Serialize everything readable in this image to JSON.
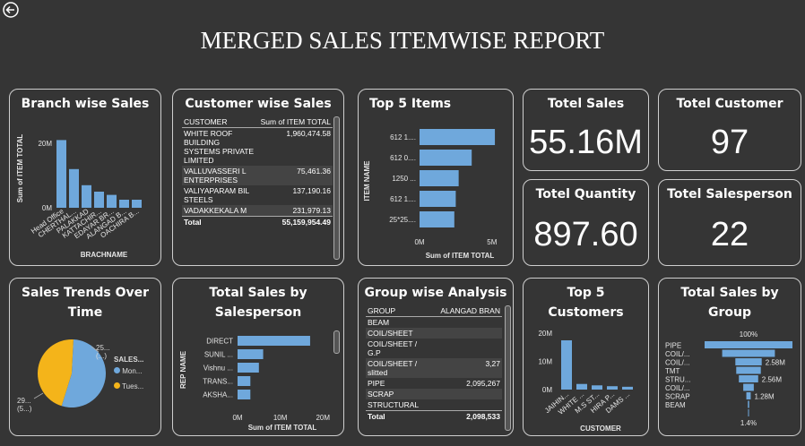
{
  "page": {
    "title": "MERGED SALES ITEMWISE REPORT",
    "accent": "#6fa8dc",
    "secondary": "#f4b41a"
  },
  "cards": {
    "branch": {
      "title": "Branch wise Sales",
      "ylabel": "Sum of ITEM TOTAL",
      "xlabel": "BRACHNAME"
    },
    "customer": {
      "title": "Customer wise Sales",
      "col1": "CUSTOMER",
      "col2": "Sum of ITEM TOTAL"
    },
    "top5items": {
      "title": "Top 5 Items",
      "ylabel": "ITEM NAME",
      "xlabel": "Sum of ITEM TOTAL"
    },
    "totel_sales": {
      "title": "Totel Sales",
      "value": "55.16M"
    },
    "totel_customer": {
      "title": "Totel Customer",
      "value": "97"
    },
    "totel_quantity": {
      "title": "Totel Quantity",
      "value": "897.60"
    },
    "totel_salesperson": {
      "title": "Totel Salesperson",
      "value": "22"
    },
    "trends": {
      "title": "Sales Trends Over Time",
      "legend_title": "SALES...",
      "legend_items": [
        "Mon...",
        "Tues..."
      ],
      "label_top": "25...",
      "label_top2": "(...)",
      "label_bottom": "29...",
      "label_bottom2": "(5...)"
    },
    "salesperson": {
      "title": "Total Sales by Salesperson",
      "ylabel": "REP NAME",
      "xlabel": "Sum of ITEM TOTAL"
    },
    "group": {
      "title": "Group wise Analysis",
      "col1": "GROUP",
      "col2": "ALANGAD BRAN"
    },
    "top5cust": {
      "title": "Top 5 Customers",
      "xlabel": "CUSTOMER"
    },
    "salesgroup": {
      "title": "Total Sales by Group",
      "top_label": "100%",
      "bottom_label": "1.4%"
    }
  },
  "customer_rows": [
    {
      "name": "WHITE ROOF BUILDING SYSTEMS PRIVATE LIMITED",
      "value": "1,960,474.58"
    },
    {
      "name": "VALLUVASSERI L ENTERPRISES",
      "value": "75,461.36"
    },
    {
      "name": "VALIYAPARAM BIL STEELS",
      "value": "137,190.16"
    },
    {
      "name": "VADAKKEKALA M",
      "value": "231,979.13"
    }
  ],
  "customer_total": {
    "label": "Total",
    "value": "55,159,954.49"
  },
  "group_rows": [
    {
      "name": "BEAM",
      "value": ""
    },
    {
      "name": "COIL/SHEET",
      "value": ""
    },
    {
      "name": "COIL/SHEET / G.P",
      "value": ""
    },
    {
      "name": "COIL/SHEET / slitted",
      "value": "3,27"
    },
    {
      "name": "PIPE",
      "value": "2,095,267"
    },
    {
      "name": "SCRAP",
      "value": ""
    },
    {
      "name": "STRUCTURAL",
      "value": ""
    }
  ],
  "group_total": {
    "label": "Total",
    "value": "2,098,533"
  },
  "chart_data": [
    {
      "type": "bar",
      "title": "Branch wise Sales",
      "categories": [
        "Head Office",
        "CHERTHAL...",
        "PALAKKAD",
        "KATTACHIR...",
        "EDAYAR BR...",
        "ALANGAD B...",
        "OACHIRA B..."
      ],
      "values": [
        21,
        12,
        7,
        5,
        4,
        2.5,
        2.5
      ],
      "ylim": [
        0,
        25
      ],
      "yticks": [
        0,
        20
      ],
      "ytick_labels": [
        "0M",
        "20M"
      ],
      "xlabel": "BRACHNAME",
      "ylabel": "Sum of ITEM TOTAL"
    },
    {
      "type": "bar",
      "orientation": "horizontal",
      "title": "Top 5 Items",
      "categories": [
        "612 1....",
        "612 0....",
        "1250 ...",
        "612 1....",
        "25*25...."
      ],
      "values": [
        5.2,
        3.6,
        2.7,
        2.5,
        2.4
      ],
      "xlim": [
        0,
        6
      ],
      "xticks": [
        0,
        5
      ],
      "xtick_labels": [
        "0M",
        "5M"
      ],
      "xlabel": "Sum of ITEM TOTAL",
      "ylabel": "ITEM NAME"
    },
    {
      "type": "pie",
      "title": "Sales Trends Over Time",
      "labels": [
        "Mon...",
        "Tues..."
      ],
      "values": [
        54,
        46
      ],
      "colors": [
        "#6fa8dc",
        "#f4b41a"
      ]
    },
    {
      "type": "bar",
      "orientation": "horizontal",
      "title": "Total Sales by Salesperson",
      "categories": [
        "DIRECT",
        "SUNIL ...",
        "Vishnu ...",
        "TRANS...",
        "AKSHA..."
      ],
      "values": [
        17,
        6,
        5,
        3,
        3
      ],
      "xlim": [
        0,
        21
      ],
      "xticks": [
        0,
        10,
        20
      ],
      "xtick_labels": [
        "0M",
        "10M",
        "20M"
      ],
      "xlabel": "Sum of ITEM TOTAL",
      "ylabel": "REP NAME"
    },
    {
      "type": "bar",
      "title": "Top 5 Customers",
      "categories": [
        "JAIHIN...",
        "WHITE ...",
        "M.S ST...",
        "HIRA P...",
        "DAMS ..."
      ],
      "values": [
        17.5,
        2.0,
        1.5,
        1.2,
        1.0
      ],
      "ylim": [
        0,
        21
      ],
      "yticks": [
        0,
        10,
        20
      ],
      "ytick_labels": [
        "0M",
        "10M",
        "20M"
      ],
      "xlabel": "CUSTOMER"
    },
    {
      "type": "funnel",
      "title": "Total Sales by Group",
      "categories": [
        "PIPE",
        "COIL/...",
        "COIL/...",
        "TMT",
        "STRU...",
        "COIL/...",
        "SCRAP",
        "BEAM"
      ],
      "values": [
        100,
        60,
        30,
        28,
        22,
        12,
        5,
        1.4
      ],
      "labels": [
        "",
        "",
        "2.58M",
        "",
        "2.56M",
        "",
        "1.28M",
        ""
      ],
      "top_label": "100%",
      "bottom_label": "1.4%"
    }
  ]
}
